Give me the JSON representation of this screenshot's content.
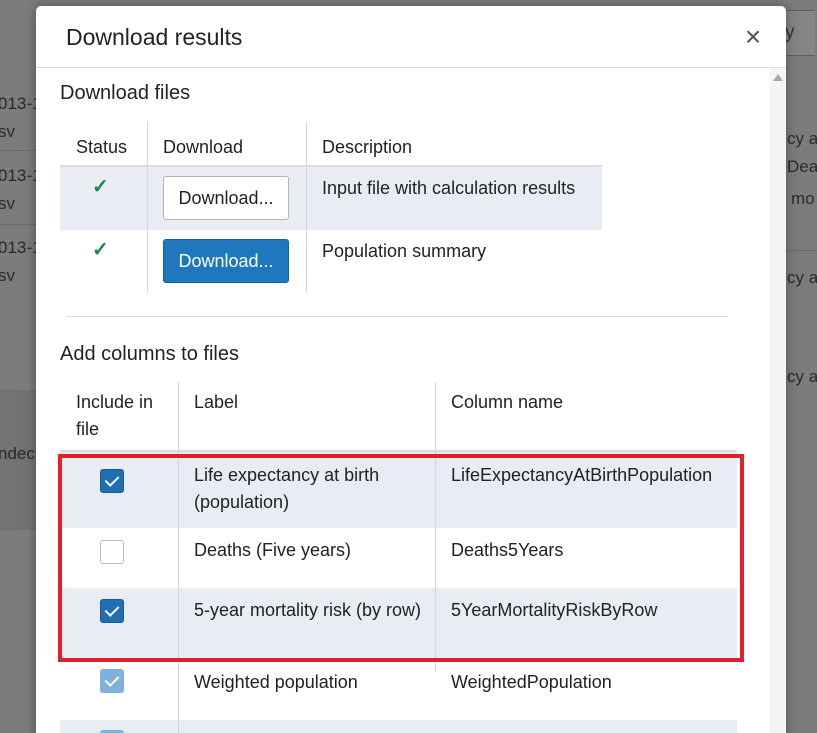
{
  "background": {
    "left_fragments": [
      "013-1",
      "sv",
      "013-1",
      "sv",
      "013-1",
      "sv",
      "ndec"
    ],
    "right_fragments": [
      "cy a",
      "Deat",
      "mo",
      "cy a",
      "cy a"
    ],
    "button_fragment": "y"
  },
  "modal": {
    "title": "Download results",
    "close_glyph": "×",
    "download_section": {
      "heading": "Download files",
      "headers": {
        "status": "Status",
        "download": "Download",
        "description": "Description"
      },
      "rows": [
        {
          "status_glyph": "✓",
          "button_label": "Download...",
          "button_style": "default",
          "description": "Input file with calculation results"
        },
        {
          "status_glyph": "✓",
          "button_label": "Download...",
          "button_style": "primary",
          "description": "Population summary"
        }
      ]
    },
    "columns_section": {
      "heading": "Add columns to files",
      "headers": {
        "include_line1": "Include in",
        "include_line2": "file",
        "label": "Label",
        "column_name": "Column name"
      },
      "rows": [
        {
          "checked": true,
          "label": "Life expectancy at birth (population)",
          "column_name": "LifeExpectancyAtBirthPopulation"
        },
        {
          "checked": false,
          "label": "Deaths (Five years)",
          "column_name": "Deaths5Years"
        },
        {
          "checked": true,
          "label": "5-year mortality risk (by row)",
          "column_name": "5YearMortalityRiskByRow"
        },
        {
          "checked": true,
          "label": "Weighted population",
          "column_name": "WeightedPopulation"
        }
      ]
    }
  },
  "colors": {
    "accent": "#1f78bf",
    "checkbox": "#1f6fb2",
    "status_check": "#1a8a4a",
    "highlight_box": "#e0202a",
    "row_shade": "#e9edf3"
  }
}
